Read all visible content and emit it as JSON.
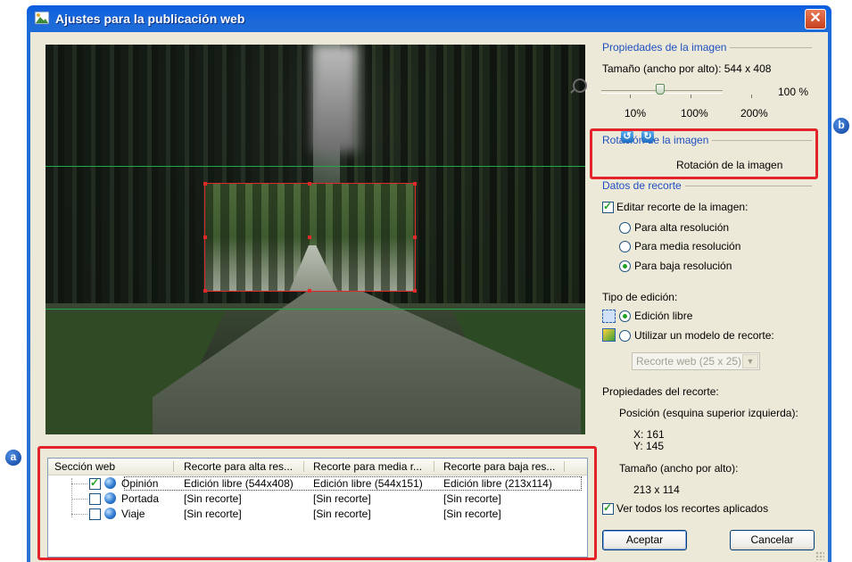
{
  "window": {
    "title": "Ajustes para la publicación web",
    "close_label": "✕"
  },
  "image_props": {
    "group_title": "Propiedades de la imagen",
    "size_text": "Tamaño (ancho por alto):  544 x 408",
    "zoom_value": "100 %",
    "zoom_percent": 100,
    "ticks": [
      "10%",
      "100%",
      "200%"
    ]
  },
  "rotation": {
    "group_title": "Rotación de la imagen",
    "left_icon": "rotate-left-icon",
    "right_icon": "rotate-right-icon",
    "label": "Rotación de la imagen"
  },
  "crop_data": {
    "group_title": "Datos de recorte",
    "edit_checkbox_label": "Editar recorte de la imagen:",
    "edit_checked": true,
    "resolutions": [
      {
        "label": "Para alta resolución",
        "selected": false
      },
      {
        "label": "Para media resolución",
        "selected": false
      },
      {
        "label": "Para baja resolución",
        "selected": true
      }
    ],
    "edit_type_label": "Tipo de edición:",
    "edit_types": [
      {
        "label": "Edición libre",
        "selected": true,
        "icon": "free-edit-icon"
      },
      {
        "label": "Utilizar un modelo de recorte:",
        "selected": false,
        "icon": "crop-model-icon"
      }
    ],
    "model_select_value": "Recorte web (25 x 25)",
    "crop_props_label": "Propiedades del recorte:",
    "position_label": "Posición (esquina superior izquierda):",
    "x_text": "X:  161",
    "y_text": "Y:  145",
    "size_label": "Tamaño (ancho por alto):",
    "size_value": "213 x 114",
    "show_all_label": "Ver todos los recortes aplicados",
    "show_all_checked": true
  },
  "buttons": {
    "accept": "Aceptar",
    "cancel": "Cancelar"
  },
  "table": {
    "headers": [
      "Sección web",
      "Recorte para alta res...",
      "Recorte para media r...",
      "Recorte para baja res..."
    ],
    "rows": [
      {
        "section": "Opinión",
        "high": "Edición libre (544x408)",
        "medium": "Edición libre (544x151)",
        "low": "Edición libre (213x114)",
        "checked": true
      },
      {
        "section": "Portada",
        "high": "[Sin recorte]",
        "medium": "[Sin recorte]",
        "low": "[Sin recorte]",
        "checked": false
      },
      {
        "section": "Viaje",
        "high": "[Sin recorte]",
        "medium": "[Sin recorte]",
        "low": "[Sin recorte]",
        "checked": false
      }
    ]
  },
  "annotations": {
    "a": "a",
    "b": "b",
    "color": "#e3242b"
  },
  "colors": {
    "title_bar": "#0a5de0",
    "group_title": "#1f4fc1",
    "crop_frame": "#e02a2a",
    "guide_line": "#1faa47"
  }
}
